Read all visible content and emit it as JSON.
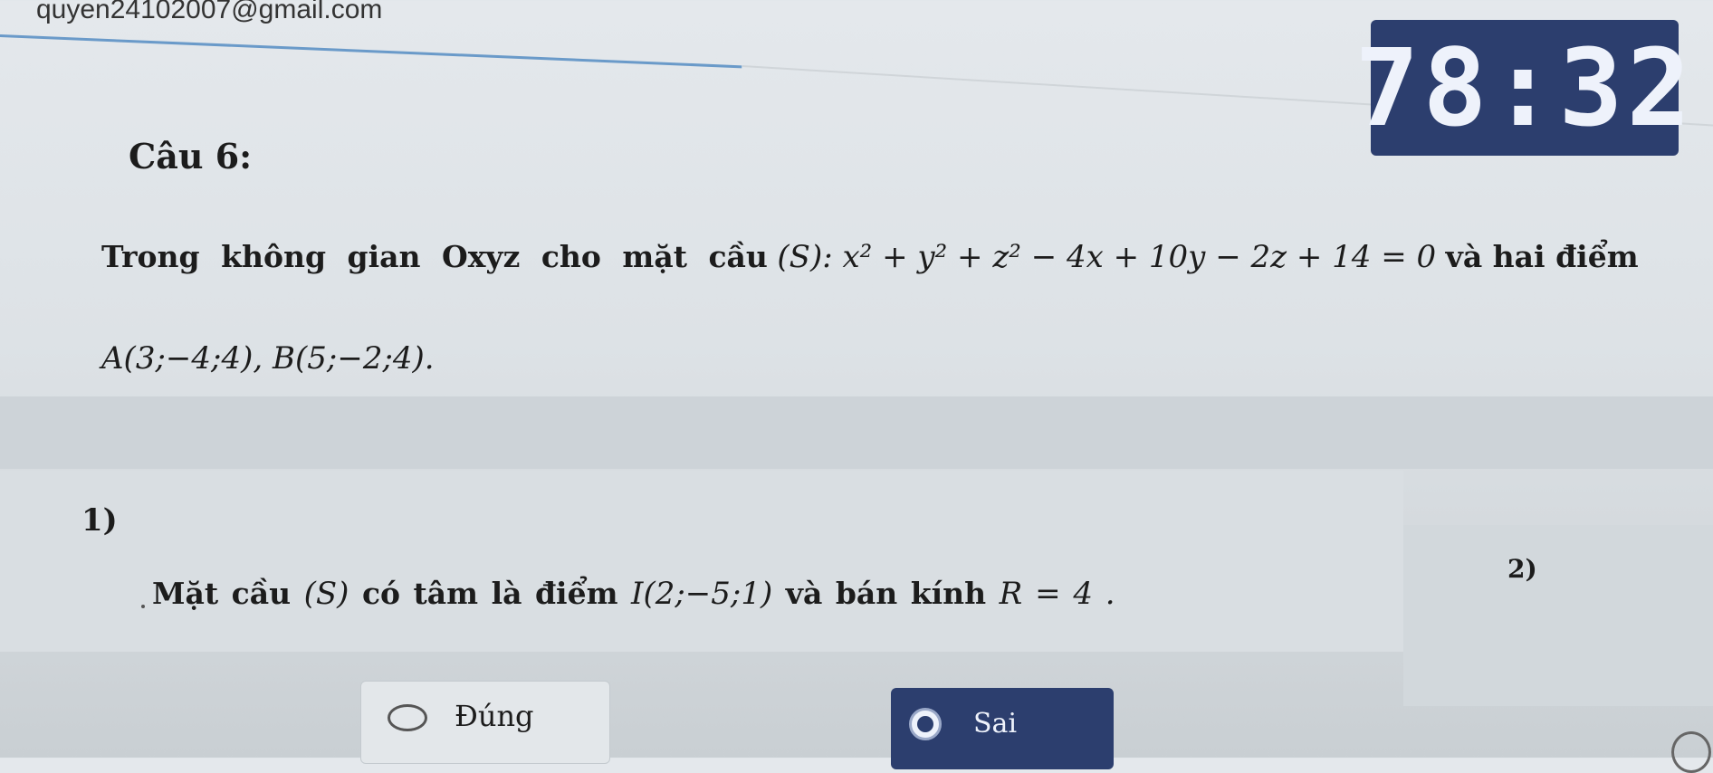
{
  "header": {
    "email": "quyen24102007@gmail.com",
    "timer": "78:32"
  },
  "question": {
    "title": "Câu 6:",
    "lead": "Trong không gian Oxyz cho mặt cầu",
    "sphere_equation": "(S): x² + y² + z² − 4x + 10y − 2z + 14 = 0",
    "tail": "và hai điểm",
    "points": "A(3;−4;4), B(5;−2;4)."
  },
  "items": [
    {
      "number": "1)",
      "statement_text": "Mặt cầu",
      "statement_math_1": "(S)",
      "statement_mid": "có tâm là điểm",
      "statement_math_2": "I(2;−5;1)",
      "statement_mid_2": "và bán kính",
      "statement_math_3": "R = 4 .",
      "options": {
        "true_label": "Đúng",
        "false_label": "Sai",
        "selected": "Sai"
      }
    },
    {
      "number": "2)"
    }
  ],
  "colors": {
    "accent": "#2c3e6e",
    "background": "#dde2e6"
  }
}
